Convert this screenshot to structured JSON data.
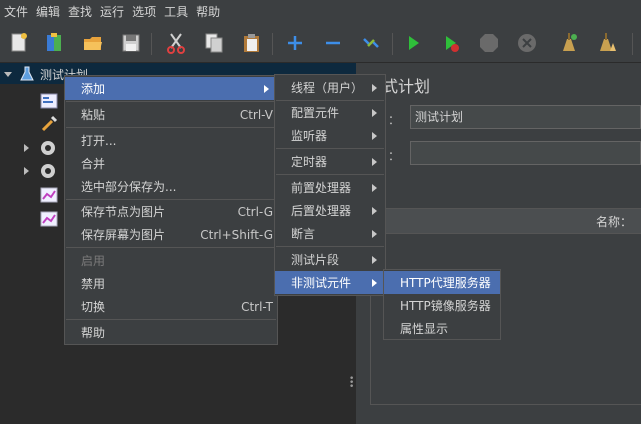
{
  "menubar": [
    "文件",
    "编辑",
    "查找",
    "运行",
    "选项",
    "工具",
    "帮助"
  ],
  "toolbar_icons": [
    "new-icon",
    "templates-icon",
    "open-icon",
    "save-icon",
    "cut-icon",
    "copy-icon",
    "paste-icon",
    "expand-icon",
    "collapse-icon",
    "toggle-icon",
    "start-icon",
    "start-no-pause-icon",
    "stop-icon",
    "shutdown-icon",
    "clear-icon",
    "clear-all-icon"
  ],
  "tree": {
    "root_label": "测试计划"
  },
  "context_menu": {
    "items": [
      {
        "label": "添加",
        "shortcut": "",
        "submenu": true,
        "highlighted": true
      },
      {
        "label": "粘贴",
        "shortcut": "Ctrl-V"
      },
      {
        "label": "打开...",
        "shortcut": ""
      },
      {
        "label": "合并",
        "shortcut": ""
      },
      {
        "label": "选中部分保存为...",
        "shortcut": ""
      },
      {
        "label": "保存节点为图片",
        "shortcut": "Ctrl-G"
      },
      {
        "label": "保存屏幕为图片",
        "shortcut": "Ctrl+Shift-G"
      },
      {
        "label": "启用",
        "shortcut": "",
        "disabled": true
      },
      {
        "label": "禁用",
        "shortcut": ""
      },
      {
        "label": "切换",
        "shortcut": "Ctrl-T"
      },
      {
        "label": "帮助",
        "shortcut": ""
      }
    ]
  },
  "add_submenu": {
    "items": [
      {
        "label": "线程（用户）"
      },
      {
        "label": "配置元件"
      },
      {
        "label": "监听器"
      },
      {
        "label": "定时器"
      },
      {
        "label": "前置处理器"
      },
      {
        "label": "后置处理器"
      },
      {
        "label": "断言"
      },
      {
        "label": "测试片段"
      },
      {
        "label": "非测试元件",
        "highlighted": true
      }
    ]
  },
  "nontest_submenu": {
    "items": [
      {
        "label": "HTTP代理服务器",
        "highlighted": true
      },
      {
        "label": "HTTP镜像服务器"
      },
      {
        "label": "属性显示"
      }
    ]
  },
  "right_panel": {
    "title": "式计划",
    "name_label": "：",
    "name_value": "测试计划",
    "comment_label": "：",
    "table_header": "名称："
  },
  "colors": {
    "highlight": "#4b6eaf",
    "background": "#3c3f41",
    "tree_bg": "#2b2b2b"
  }
}
